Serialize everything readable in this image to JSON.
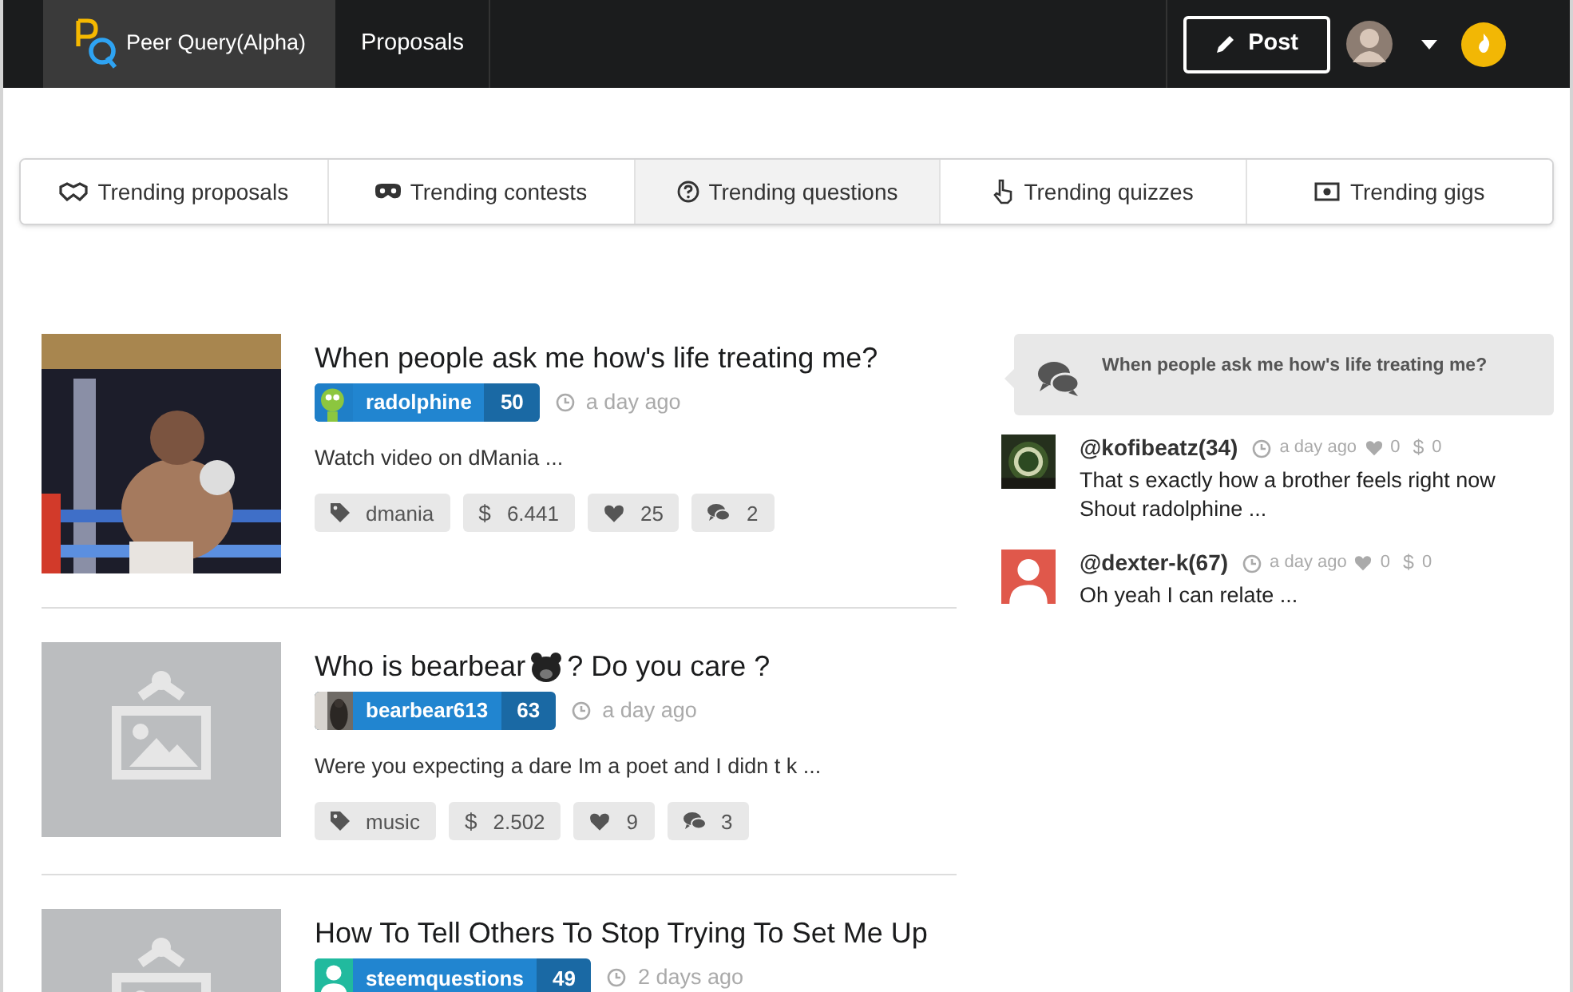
{
  "nav": {
    "brand": "Peer Query(Alpha)",
    "brand_selected": true,
    "items": [
      {
        "label": "Proposals",
        "selected": false
      }
    ],
    "post_button": "Post"
  },
  "tabs": [
    {
      "label": "Trending proposals",
      "kind": "handshake",
      "selected": false
    },
    {
      "label": "Trending contests",
      "kind": "mask",
      "selected": false
    },
    {
      "label": "Trending questions",
      "kind": "question",
      "selected": true
    },
    {
      "label": "Trending quizzes",
      "kind": "pointer",
      "selected": false
    },
    {
      "label": "Trending gigs",
      "kind": "money",
      "selected": false
    }
  ],
  "posts": [
    {
      "title_parts": [
        {
          "kind": "text",
          "text": "When people ask me how's life treating me?"
        }
      ],
      "thumbnail": {
        "kind": "picture"
      },
      "avatar": {
        "kind": "picture"
      },
      "author": "radolphine",
      "reputation": "50",
      "time": "a day ago",
      "excerpt": "Watch video on dMania ...",
      "tag": "dmania",
      "currency": "$",
      "payout": "6.441",
      "votes": "25",
      "comments": "2"
    },
    {
      "title_parts": [
        {
          "kind": "text",
          "text": "Who is bearbear"
        },
        {
          "kind": "bear"
        },
        {
          "kind": "text",
          "text": "? Do you care ?"
        }
      ],
      "thumbnail": {
        "kind": "placeholder"
      },
      "avatar": {
        "kind": "picture"
      },
      "author": "bearbear613",
      "reputation": "63",
      "time": "a day ago",
      "excerpt": "Were you expecting a dare Im a poet and I didn t k ...",
      "tag": "music",
      "currency": "$",
      "payout": "2.502",
      "votes": "9",
      "comments": "3"
    },
    {
      "title_parts": [
        {
          "kind": "text",
          "text": "How To Tell Others To Stop Trying To Set Me Up"
        }
      ],
      "thumbnail": {
        "kind": "placeholder"
      },
      "avatar": {
        "kind": "silhouette",
        "color": "#21ba9e"
      },
      "author": "steemquestions",
      "reputation": "49",
      "time": "2 days ago"
    }
  ],
  "sidebar": {
    "question": "When people ask me how's life treating me?",
    "comments": [
      {
        "avatar": {
          "kind": "picture"
        },
        "author": "@kofibeatz(34)",
        "time": "a day ago",
        "votes": "0",
        "currency": "$",
        "payout": "0",
        "text": "That s exactly how a brother feels right now Shout radolphine ..."
      },
      {
        "avatar": {
          "kind": "silhouette",
          "color": "#e0584b"
        },
        "author": "@dexter-k(67)",
        "time": "a day ago",
        "votes": "0",
        "currency": "$",
        "payout": "0",
        "text": "Oh yeah I can relate ..."
      }
    ]
  }
}
